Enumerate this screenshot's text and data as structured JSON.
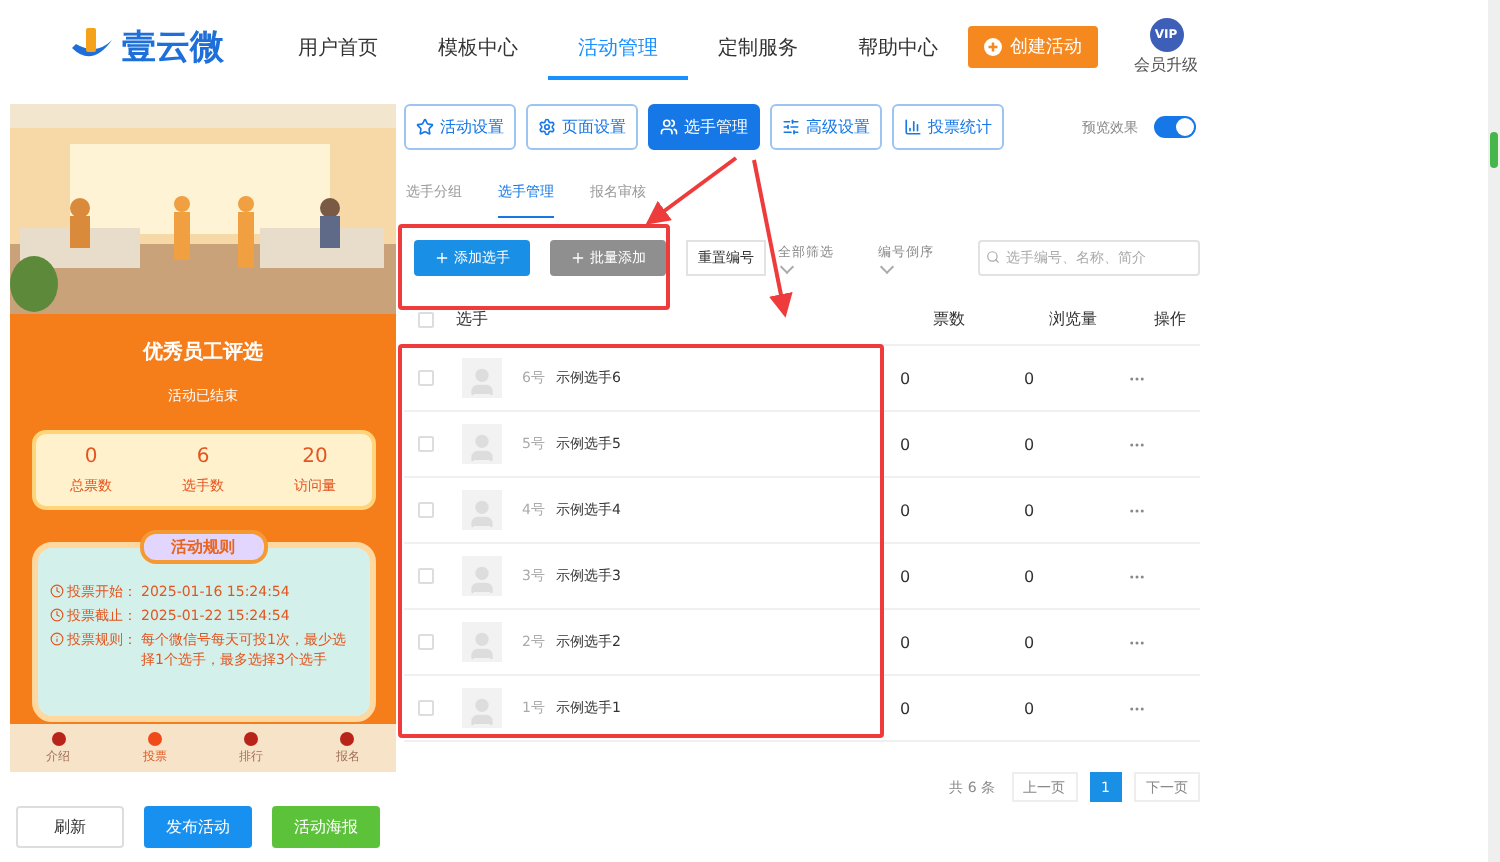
{
  "header": {
    "logo": "壹云微",
    "nav": [
      {
        "label": "用户首页",
        "selected": false
      },
      {
        "label": "模板中心",
        "selected": false
      },
      {
        "label": "活动管理",
        "selected": true
      },
      {
        "label": "定制服务",
        "selected": false
      },
      {
        "label": "帮助中心",
        "selected": false
      }
    ],
    "create_button": "创建活动",
    "vip": {
      "badge": "VIP",
      "label": "会员升级"
    }
  },
  "preview": {
    "title": "优秀员工评选",
    "status": "活动已结束",
    "stats": [
      {
        "value": "0",
        "label": "总票数"
      },
      {
        "value": "6",
        "label": "选手数"
      },
      {
        "value": "20",
        "label": "访问量"
      }
    ],
    "rules_title": "活动规则",
    "rules": [
      {
        "kind": "clock",
        "label": "投票开始：",
        "text": "2025-01-16 15:24:54"
      },
      {
        "kind": "clock",
        "label": "投票截止：",
        "text": "2025-01-22 15:24:54"
      },
      {
        "kind": "info",
        "label": "投票规则：",
        "text": "每个微信号每天可投1次，最少选择1个选手，最多选择3个选手"
      }
    ],
    "bottom_nav": [
      {
        "label": "介绍",
        "selected": false
      },
      {
        "label": "投票",
        "selected": true
      },
      {
        "label": "排行",
        "selected": false
      },
      {
        "label": "报名",
        "selected": false
      }
    ]
  },
  "actions": [
    {
      "label": "刷新",
      "kind": "plain"
    },
    {
      "label": "发布活动",
      "kind": "blue"
    },
    {
      "label": "活动海报",
      "kind": "green"
    }
  ],
  "toolbar": [
    {
      "label": "活动设置",
      "selected": false
    },
    {
      "label": "页面设置",
      "selected": false
    },
    {
      "label": "选手管理",
      "selected": true
    },
    {
      "label": "高级设置",
      "selected": false
    },
    {
      "label": "投票统计",
      "selected": false
    }
  ],
  "preview_toggle": {
    "label": "预览效果",
    "on": true
  },
  "sub_tabs": [
    {
      "label": "选手分组",
      "selected": false
    },
    {
      "label": "选手管理",
      "selected": true
    },
    {
      "label": "报名审核",
      "selected": false
    }
  ],
  "add_buttons": [
    {
      "label": "添加选手",
      "kind": "blue"
    },
    {
      "label": "批量添加",
      "kind": "gray"
    }
  ],
  "reset_button": "重置编号",
  "filters": [
    "全部筛选",
    "编号倒序"
  ],
  "search": {
    "placeholder": "选手编号、名称、简介"
  },
  "table": {
    "header_checked": false,
    "columns": [
      "选手",
      "票数",
      "浏览量",
      "操作"
    ],
    "rows": [
      {
        "number": "6号",
        "name": "示例选手6",
        "votes": "0",
        "views": "0",
        "checked": false
      },
      {
        "number": "5号",
        "name": "示例选手5",
        "votes": "0",
        "views": "0",
        "checked": false
      },
      {
        "number": "4号",
        "name": "示例选手4",
        "votes": "0",
        "views": "0",
        "checked": false
      },
      {
        "number": "3号",
        "name": "示例选手3",
        "votes": "0",
        "views": "0",
        "checked": false
      },
      {
        "number": "2号",
        "name": "示例选手2",
        "votes": "0",
        "views": "0",
        "checked": false
      },
      {
        "number": "1号",
        "name": "示例选手1",
        "votes": "0",
        "views": "0",
        "checked": false
      }
    ]
  },
  "pagination": {
    "total": "共 6 条",
    "prev": "上一页",
    "pages": [
      {
        "label": "1",
        "selected": true
      }
    ],
    "next": "下一页"
  }
}
